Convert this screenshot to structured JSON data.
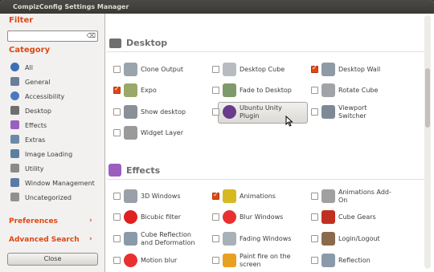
{
  "window": {
    "title": "CompizConfig Settings Manager"
  },
  "sidebar": {
    "filter_heading": "Filter",
    "filter_value": "",
    "category_heading": "Category",
    "categories": [
      {
        "label": "All",
        "icon": "globe-icon",
        "color": "#3d6fb5"
      },
      {
        "label": "General",
        "icon": "general-settings-icon",
        "color": "#6b7d9a"
      },
      {
        "label": "Accessibility",
        "icon": "accessibility-icon",
        "color": "#4a78c0"
      },
      {
        "label": "Desktop",
        "icon": "desktop-icon",
        "color": "#6f6f6f"
      },
      {
        "label": "Effects",
        "icon": "effects-sparkle-icon",
        "color": "#9b5fc0"
      },
      {
        "label": "Extras",
        "icon": "extras-icon",
        "color": "#6b8aa8"
      },
      {
        "label": "Image Loading",
        "icon": "image-loading-icon",
        "color": "#5c7fa0"
      },
      {
        "label": "Utility",
        "icon": "utility-icon",
        "color": "#8a8a8a"
      },
      {
        "label": "Window Management",
        "icon": "window-management-icon",
        "color": "#5a7aa5"
      },
      {
        "label": "Uncategorized",
        "icon": "uncategorized-icon",
        "color": "#909090"
      }
    ],
    "preferences_label": "Preferences",
    "advanced_search_label": "Advanced Search",
    "close_label": "Close",
    "accent": "#dd4814"
  },
  "sections": [
    {
      "title": "Desktop",
      "icon": "desktop-section-icon",
      "items": [
        {
          "label": "Clone Output",
          "checked": false,
          "icon": "clone-output-icon",
          "color": "#9aa4ad"
        },
        {
          "label": "Desktop Cube",
          "checked": false,
          "icon": "desktop-cube-icon",
          "color": "#b8bcc0"
        },
        {
          "label": "Desktop Wall",
          "checked": true,
          "icon": "desktop-wall-icon",
          "color": "#8e9aa6"
        },
        {
          "label": "Expo",
          "checked": true,
          "icon": "expo-icon",
          "color": "#9aa86a"
        },
        {
          "label": "Fade to Desktop",
          "checked": false,
          "icon": "fade-to-desktop-icon",
          "color": "#7f9a6a"
        },
        {
          "label": "Rotate Cube",
          "checked": false,
          "icon": "rotate-cube-icon",
          "color": "#a0a4a8"
        },
        {
          "label": "Show desktop",
          "checked": false,
          "icon": "show-desktop-icon",
          "color": "#8a9098"
        },
        {
          "label": "Ubuntu Unity Plugin",
          "checked": false,
          "icon": "ubuntu-unity-icon",
          "color": "#6a3b8a"
        },
        {
          "label": "Viewport Switcher",
          "checked": false,
          "icon": "viewport-switcher-icon",
          "color": "#7d8a96"
        },
        {
          "label": "Widget Layer",
          "checked": false,
          "icon": "widget-layer-icon",
          "color": "#9a9a9a"
        }
      ]
    },
    {
      "title": "Effects",
      "icon": "effects-section-icon",
      "items": [
        {
          "label": "3D Windows",
          "checked": false,
          "icon": "3d-windows-icon",
          "color": "#9aa0a8"
        },
        {
          "label": "Animations",
          "checked": true,
          "icon": "animations-icon",
          "color": "#d8b820"
        },
        {
          "label": "Animations Add-On",
          "checked": false,
          "icon": "animations-addon-icon",
          "color": "#a0a0a0"
        },
        {
          "label": "Bicubic filter",
          "checked": false,
          "icon": "bicubic-filter-icon",
          "color": "#e02020"
        },
        {
          "label": "Blur Windows",
          "checked": false,
          "icon": "blur-windows-icon",
          "color": "#e83030"
        },
        {
          "label": "Cube Gears",
          "checked": false,
          "icon": "cube-gears-icon",
          "color": "#c03020"
        },
        {
          "label": "Cube Reflection and Deformation",
          "checked": false,
          "icon": "cube-reflection-icon",
          "color": "#8a9aaa"
        },
        {
          "label": "Fading Windows",
          "checked": false,
          "icon": "fading-windows-icon",
          "color": "#a8b0b8"
        },
        {
          "label": "Login/Logout",
          "checked": false,
          "icon": "login-logout-icon",
          "color": "#8a6a4a"
        },
        {
          "label": "Motion blur",
          "checked": false,
          "icon": "motion-blur-icon",
          "color": "#e83030"
        },
        {
          "label": "Paint fire on the screen",
          "checked": false,
          "icon": "paint-fire-icon",
          "color": "#e8a020"
        },
        {
          "label": "Reflection",
          "checked": false,
          "icon": "reflection-icon",
          "color": "#8a9aaa"
        }
      ]
    }
  ]
}
